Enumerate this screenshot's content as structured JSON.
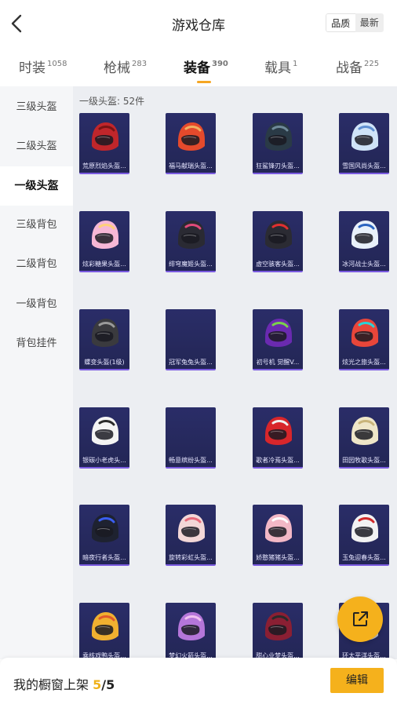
{
  "header": {
    "title": "游戏仓库",
    "sort_options": [
      "品质",
      "最新"
    ]
  },
  "tabs": [
    {
      "label": "时装",
      "count": "1058"
    },
    {
      "label": "枪械",
      "count": "283"
    },
    {
      "label": "装备",
      "count": "390"
    },
    {
      "label": "载具",
      "count": "1"
    },
    {
      "label": "战备",
      "count": "225"
    }
  ],
  "sidebar": {
    "items": [
      {
        "label": "三级头盔"
      },
      {
        "label": "二级头盔"
      },
      {
        "label": "一级头盔"
      },
      {
        "label": "三级背包"
      },
      {
        "label": "二级背包"
      },
      {
        "label": "一级背包"
      },
      {
        "label": "背包挂件"
      }
    ]
  },
  "content": {
    "count_label": "一级头盔: 52件",
    "items": [
      {
        "name": "荒原烈焰头盔...",
        "color": "#c0262b",
        "accent": "#7a1414"
      },
      {
        "name": "福马献瑞头盔...",
        "color": "#e44a2c",
        "accent": "#f0b060"
      },
      {
        "name": "狂鲨锋刃头盔...",
        "color": "#2a3a46",
        "accent": "#6f8a9a"
      },
      {
        "name": "雪国风尚头盔...",
        "color": "#cfe3f7",
        "accent": "#5e8fd0"
      },
      {
        "name": "炫彩糖果头盔...",
        "color": "#f6b7d6",
        "accent": "#ffd07a"
      },
      {
        "name": "绯穹魔姬头盔...",
        "color": "#2a2a33",
        "accent": "#e04a7a"
      },
      {
        "name": "虚空骇客头盔...",
        "color": "#2b2b33",
        "accent": "#e03030"
      },
      {
        "name": "冰河战士头盔...",
        "color": "#e8f0fa",
        "accent": "#2b64c0"
      },
      {
        "name": "蝶变头盔(1级)",
        "color": "#3a3a3e",
        "accent": "#9a9a9a"
      },
      {
        "name": "冠军兔兔头盔...",
        "color": "",
        "accent": ""
      },
      {
        "name": "初号机 觉醒V...",
        "color": "#6a2ab0",
        "accent": "#7ad14a"
      },
      {
        "name": "炫光之旅头盔...",
        "color": "#e8463a",
        "accent": "#2ad3d8"
      },
      {
        "name": "银碳小老虎头...",
        "color": "#f4f4f4",
        "accent": "#2a2a2a"
      },
      {
        "name": "畅意缤纷头盔...",
        "color": "",
        "accent": ""
      },
      {
        "name": "歌者冷焉头盔...",
        "color": "#d8262b",
        "accent": "#f0f0f0"
      },
      {
        "name": "田园牧歌头盔...",
        "color": "#efe6c8",
        "accent": "#c9b47a"
      },
      {
        "name": "暗夜行者头盔...",
        "color": "#1e2230",
        "accent": "#3a5ef0"
      },
      {
        "name": "旋转彩虹头盔...",
        "color": "#f3d7d7",
        "accent": "#e86a7a"
      },
      {
        "name": "娇憨猪猪头盔...",
        "color": "#f3b8c6",
        "accent": "#ffffff"
      },
      {
        "name": "玉兔迎春头盔...",
        "color": "#f2f2f2",
        "accent": "#d02a2a"
      },
      {
        "name": "乘核戏鸭头盔...",
        "color": "#f0b030",
        "accent": "#e05a2a"
      },
      {
        "name": "梦幻火箭头盔...",
        "color": "#b576d9",
        "accent": "#f0c0f0"
      },
      {
        "name": "甜心业梦头盔...",
        "color": "#8a1f33",
        "accent": "#2a2a2a"
      },
      {
        "name": "环太平洋头盔...",
        "color": "#c0c0c8",
        "accent": "#3060c0"
      }
    ]
  },
  "bottom": {
    "shelf_text": "我的橱窗上架",
    "current": "5",
    "sep": "/",
    "total": "5",
    "edit_label": "编辑"
  }
}
